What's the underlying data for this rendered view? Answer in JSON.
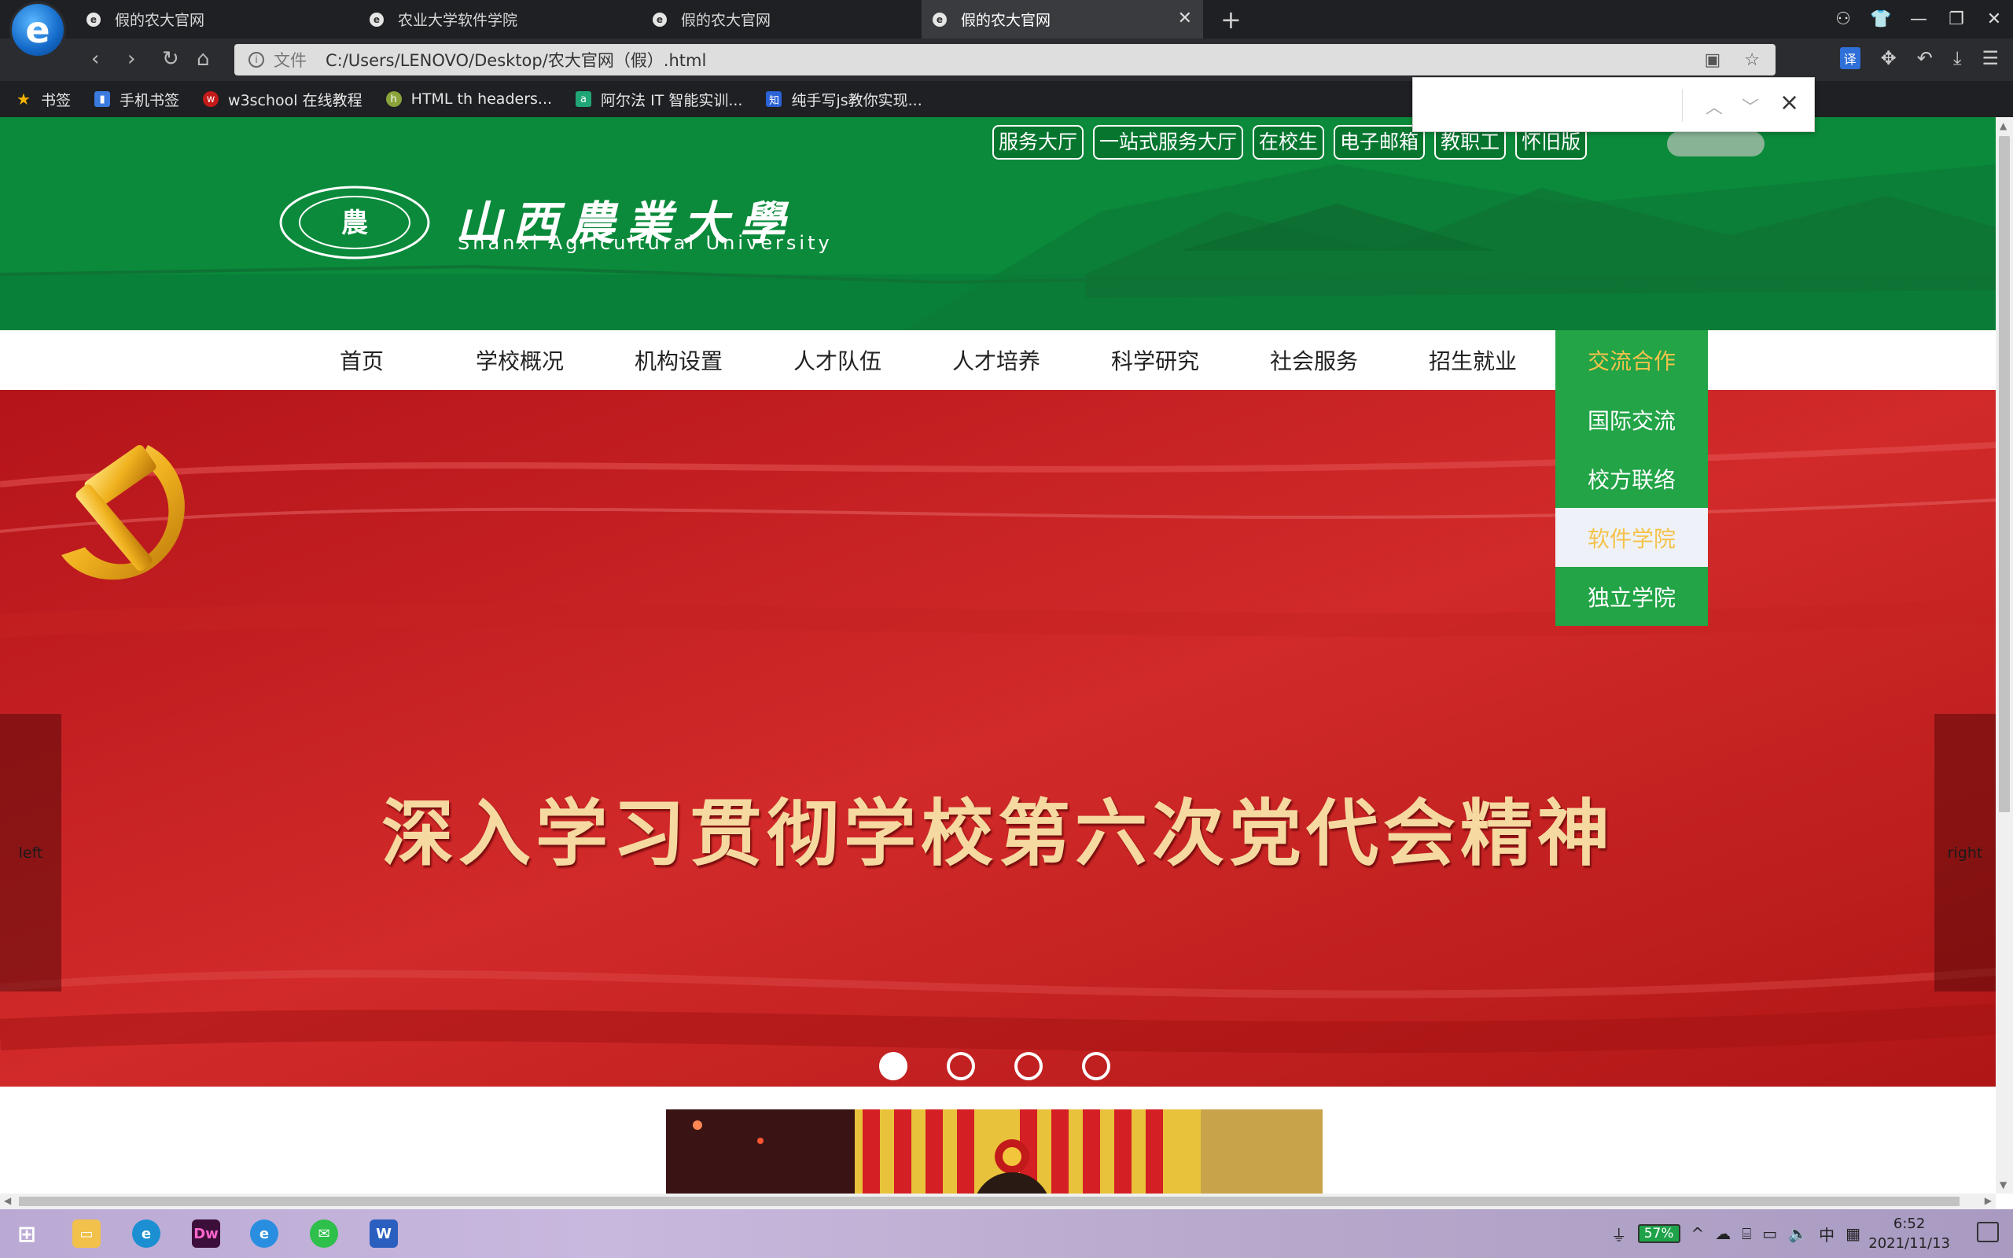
{
  "browser": {
    "tabs": [
      {
        "title": "假的农大官网",
        "active": false
      },
      {
        "title": "农业大学软件学院",
        "active": false
      },
      {
        "title": "假的农大官网",
        "active": false
      },
      {
        "title": "假的农大官网",
        "active": true
      }
    ],
    "address": {
      "scheme_label": "文件",
      "url": "C:/Users/LENOVO/Desktop/农大官网（假）.html"
    },
    "bookmarks": [
      {
        "label": "书签",
        "icon": "star-icon"
      },
      {
        "label": "手机书签",
        "icon": "phone-bookmark-icon"
      },
      {
        "label": "w3school 在线教程",
        "icon": "w3school-icon"
      },
      {
        "label": "HTML th headers...",
        "icon": "html-icon"
      },
      {
        "label": "阿尔法 IT 智能实训...",
        "icon": "alpha-icon"
      },
      {
        "label": "纯手写js教你实现...",
        "icon": "zhihu-icon"
      }
    ],
    "find_bar": {
      "value": ""
    }
  },
  "site": {
    "top_links": [
      "服务大厅",
      "一站式服务大厅",
      "在校生",
      "电子邮箱",
      "教职工",
      "怀旧版"
    ],
    "logo": {
      "cn": "山西農業大學",
      "en": "Shanxi Agricultural University"
    },
    "nav": [
      "首页",
      "学校概况",
      "机构设置",
      "人才队伍",
      "人才培养",
      "科学研究",
      "社会服务",
      "招生就业",
      "交流合作"
    ],
    "active_nav": "交流合作",
    "dropdown": [
      "国际交流",
      "校方联络",
      "软件学院",
      "独立学院"
    ],
    "dropdown_hover": "软件学院",
    "banner": {
      "title": "深入学习贯彻学校第六次党代会精神",
      "left": "left",
      "right": "right",
      "slides": 4,
      "current_slide": 1
    }
  },
  "taskbar": {
    "battery": "57%",
    "ime": "中",
    "time": "6:52",
    "date": "2021/11/13"
  },
  "colors": {
    "header_green": "#0a8a3a",
    "nav_active_bg": "#22a447",
    "nav_active_text": "#f5c24a",
    "banner_red": "#c0191d"
  }
}
